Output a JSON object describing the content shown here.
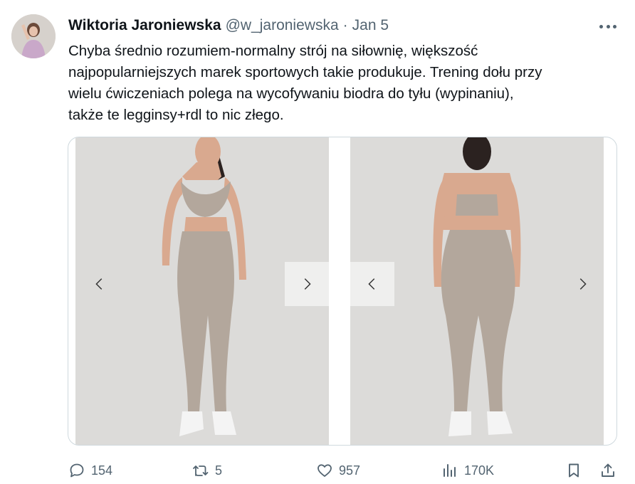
{
  "tweet": {
    "display_name": "Wiktoria Jaroniewska",
    "handle": "@w_jaroniewska",
    "separator": "·",
    "date": "Jan 5",
    "text": "Chyba średnio rozumiem-normalny strój na siłownię, większość\nnajpopularniejszych marek sportowych takie produkuje. Trening dołu przy\nwielu ćwiczeniach polega na wycofywaniu biodra do tyłu (wypinaniu),\ntakże te legginsy+rdl to nic złego."
  },
  "media": {
    "images": [
      {
        "icon": "photo-front-view"
      },
      {
        "icon": "photo-back-view"
      }
    ]
  },
  "actions": {
    "replies": "154",
    "retweets": "5",
    "likes": "957",
    "views": "170K"
  },
  "colors": {
    "text": "#0f1419",
    "secondary": "#536471",
    "border": "#cfd9de",
    "photo_bg": "#dcdbd9",
    "outfit": "#b3a79c"
  }
}
